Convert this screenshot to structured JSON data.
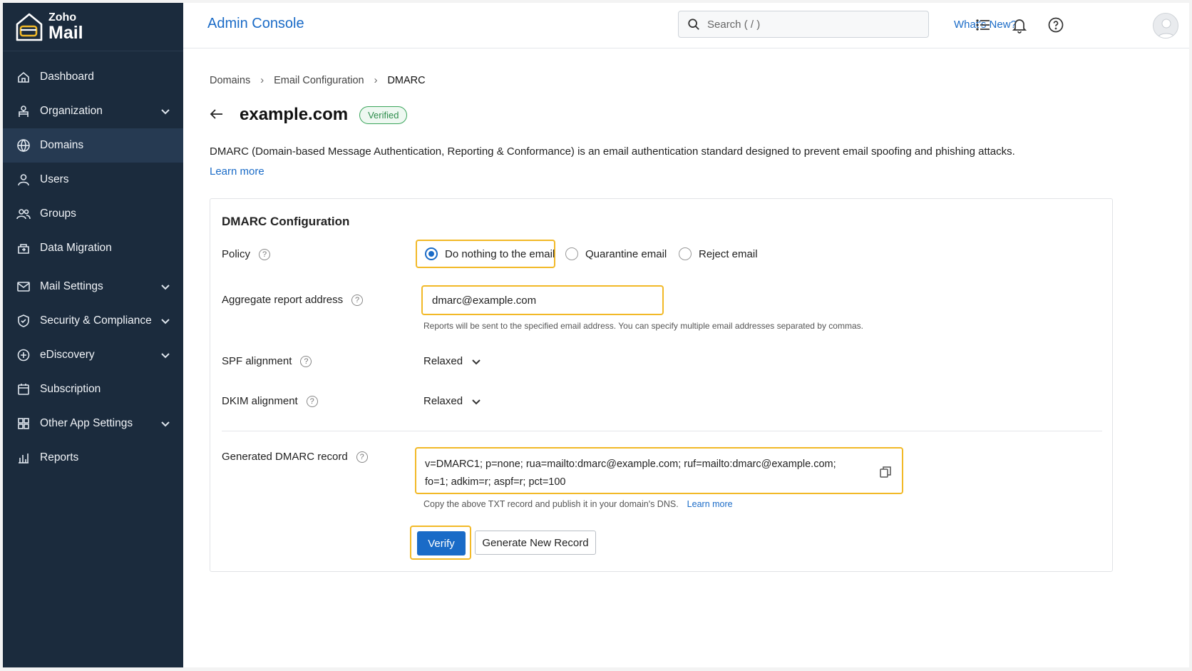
{
  "brand": {
    "small": "Zoho",
    "big": "Mail"
  },
  "sidebar": {
    "items": [
      {
        "label": "Dashboard",
        "icon": "home-icon",
        "active": false,
        "expandable": false
      },
      {
        "label": "Organization",
        "icon": "organization-icon",
        "active": false,
        "expandable": true
      },
      {
        "label": "Domains",
        "icon": "globe-icon",
        "active": true,
        "expandable": false
      },
      {
        "label": "Users",
        "icon": "user-icon",
        "active": false,
        "expandable": false
      },
      {
        "label": "Groups",
        "icon": "groups-icon",
        "active": false,
        "expandable": false
      },
      {
        "label": "Data Migration",
        "icon": "migration-icon",
        "active": false,
        "expandable": false
      },
      {
        "label": "Mail Settings",
        "icon": "mail-icon",
        "active": false,
        "expandable": true
      },
      {
        "label": "Security & Compliance",
        "icon": "shield-icon",
        "active": false,
        "expandable": true
      },
      {
        "label": "eDiscovery",
        "icon": "ediscovery-icon",
        "active": false,
        "expandable": true
      },
      {
        "label": "Subscription",
        "icon": "calendar-icon",
        "active": false,
        "expandable": false
      },
      {
        "label": "Other App Settings",
        "icon": "apps-grid-icon",
        "active": false,
        "expandable": true
      },
      {
        "label": "Reports",
        "icon": "chart-icon",
        "active": false,
        "expandable": false
      }
    ]
  },
  "header": {
    "title": "Admin Console",
    "search_placeholder": "Search ( / )",
    "whats_new": "What's New?"
  },
  "breadcrumb": {
    "items": [
      "Domains",
      "Email Configuration"
    ],
    "current": "DMARC"
  },
  "page": {
    "domain": "example.com",
    "badge": "Verified",
    "description": "DMARC (Domain-based Message Authentication, Reporting & Conformance) is an email authentication standard designed to prevent email spoofing and phishing attacks.",
    "learn_more": "Learn more"
  },
  "dmarc": {
    "card_title": "DMARC Configuration",
    "policy_label": "Policy",
    "policy_options": [
      "Do nothing to the email",
      "Quarantine email",
      "Reject email"
    ],
    "policy_selected": "Do nothing to the email",
    "aggregate_label": "Aggregate report address",
    "aggregate_value": "dmarc@example.com",
    "aggregate_hint": "Reports will be sent to the specified email address. You can specify multiple email addresses separated by commas.",
    "spf_label": "SPF alignment",
    "spf_value": "Relaxed",
    "dkim_label": "DKIM alignment",
    "dkim_value": "Relaxed",
    "record_label": "Generated DMARC record",
    "record_line1": "v=DMARC1;  p=none;  rua=mailto:dmarc@example.com;  ruf=mailto:dmarc@example.com;",
    "record_line2": "fo=1;  adkim=r;  aspf=r;  pct=100",
    "copy_note": "Copy the above TXT record and publish it in your domain's DNS.",
    "copy_learn_more": "Learn more",
    "verify_label": "Verify",
    "generate_label": "Generate New Record"
  },
  "colors": {
    "sidebar": "#1b2b3d",
    "accent": "#1a6bc7",
    "highlight": "#f2b927",
    "verified": "#2e8d4c"
  }
}
